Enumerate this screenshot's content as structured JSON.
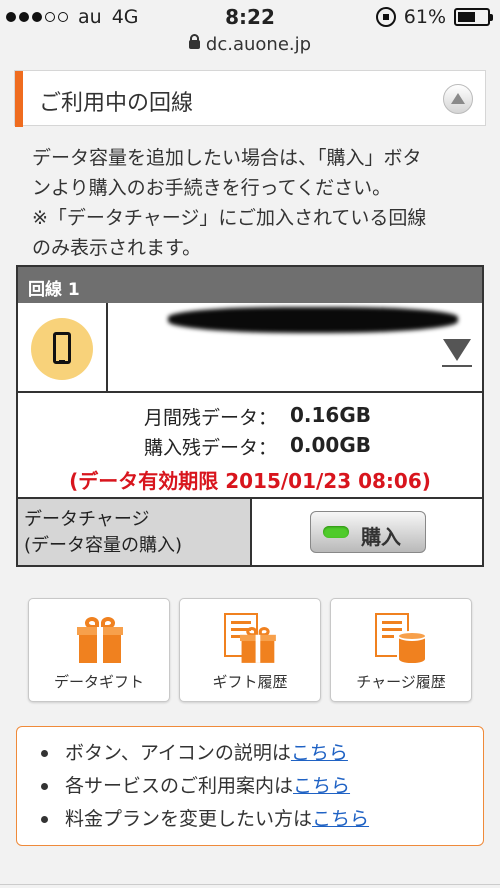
{
  "status": {
    "carrier": "au",
    "network": "4G",
    "time": "8:22",
    "battery_pct": "61%",
    "battery_fraction": 0.61,
    "signal_bars": 3
  },
  "url": "dc.auone.jp",
  "section": {
    "title": "ご利用中の回線"
  },
  "description": [
    "データ容量を追加したい場合は、「購入」ボタ",
    "ンより購入のお手続きを行ってください。",
    "※「データチャージ」にご加入されている回線",
    "のみ表示されます。"
  ],
  "line": {
    "header": "回線 1",
    "monthly_label": "月間残データ：",
    "monthly_value": "0.16GB",
    "purchased_label": "購入残データ：",
    "purchased_value": "0.00GB",
    "expiry": "(データ有効期限 2015/01/23 08:06)",
    "charge_label_1": "データチャージ",
    "charge_label_2": "(データ容量の購入)",
    "buy_label": "購入"
  },
  "tiles": [
    {
      "label": "データギフト",
      "icon": "gift-icon"
    },
    {
      "label": "ギフト履歴",
      "icon": "gift-history-icon"
    },
    {
      "label": "チャージ履歴",
      "icon": "charge-history-icon"
    }
  ],
  "links": [
    {
      "text": "ボタン、アイコンの説明は",
      "link": "こちら"
    },
    {
      "text": "各サービスのご利用案内は",
      "link": "こちら"
    },
    {
      "text": "料金プランを変更したい方は",
      "link": "こちら"
    }
  ],
  "colors": {
    "accent": "#ef6c1f",
    "expiry_red": "#d8151d",
    "link_blue": "#1f62c4",
    "buy_led": "#4fcb2b"
  }
}
